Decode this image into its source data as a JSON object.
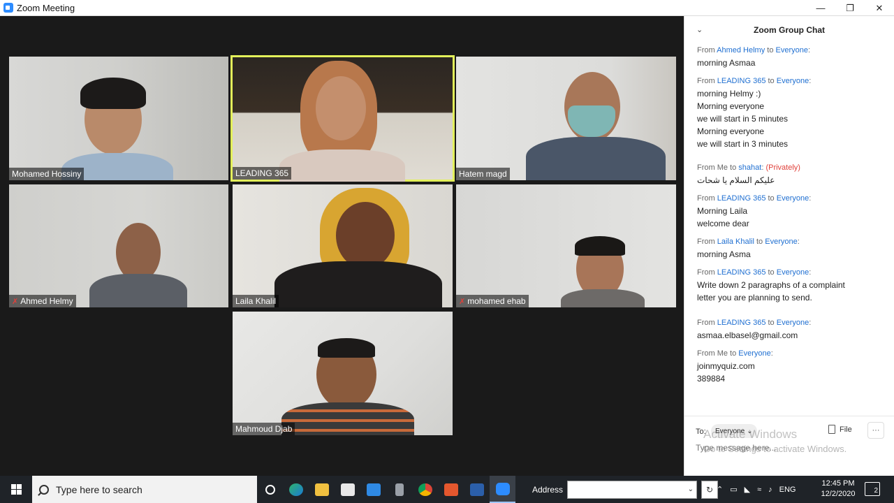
{
  "window": {
    "title": "Zoom Meeting",
    "minimize_icon": "minimize-icon",
    "restore_icon": "restore-icon",
    "close_icon": "close-icon"
  },
  "participants": [
    {
      "name": "Mohamed Hossiny",
      "muted": false
    },
    {
      "name": "LEADING 365",
      "muted": false,
      "active_speaker": true
    },
    {
      "name": "Hatem magd",
      "muted": false
    },
    {
      "name": "Ahmed Helmy",
      "muted": true
    },
    {
      "name": "Laila Khalil",
      "muted": false
    },
    {
      "name": "mohamed ehab",
      "muted": true
    },
    {
      "name": "Mahmoud Djab",
      "muted": false
    }
  ],
  "chat": {
    "title": "Zoom Group Chat",
    "messages": [
      {
        "from_label": "From ",
        "sender": "Ahmed Helmy",
        "to_label": " to ",
        "recipient": "Everyone",
        "colon": ":",
        "private": "",
        "lines": [
          "morning Asmaa"
        ]
      },
      {
        "from_label": "From ",
        "sender": "LEADING 365",
        "to_label": " to ",
        "recipient": "Everyone",
        "colon": ":",
        "private": "",
        "lines": [
          "morning Helmy :)",
          "Morning everyone",
          "we will start in 5 minutes",
          "Morning everyone",
          "we will start in 3 minutes"
        ]
      },
      {
        "from_label": "From Me to ",
        "sender": "",
        "to_label": "",
        "recipient": "shahat",
        "colon": ":",
        "private": "(Privately)",
        "lines": [
          "عليكم السلام يا شحات"
        ]
      },
      {
        "from_label": "From ",
        "sender": "LEADING 365",
        "to_label": " to ",
        "recipient": "Everyone",
        "colon": ":",
        "private": "",
        "lines": [
          "Morning Laila",
          "welcome dear"
        ]
      },
      {
        "from_label": "From ",
        "sender": "Laila Khalil",
        "to_label": " to ",
        "recipient": "Everyone",
        "colon": ":",
        "private": "",
        "lines": [
          "morning Asma"
        ]
      },
      {
        "from_label": "From ",
        "sender": "LEADING 365",
        "to_label": " to ",
        "recipient": "Everyone",
        "colon": ":",
        "private": "",
        "lines": [
          "Write down 2 paragraphs of a complaint",
          "letter you are planning to send."
        ]
      },
      {
        "from_label": "From ",
        "sender": "LEADING 365",
        "to_label": " to ",
        "recipient": "Everyone",
        "colon": ":",
        "private": "",
        "lines": [
          "asmaa.elbasel@gmail.com"
        ]
      },
      {
        "from_label": "From Me to ",
        "sender": "",
        "to_label": "",
        "recipient": "Everyone",
        "colon": ":",
        "private": "",
        "lines": [
          "joinmyquiz.com",
          "389884"
        ]
      }
    ],
    "to_label": "To:",
    "to_value": "Everyone",
    "file_label": "File",
    "more_label": "···",
    "input_placeholder": "Type message here...",
    "watermark_title": "Activate Windows",
    "watermark_sub": "Go to Settings to activate Windows."
  },
  "taskbar": {
    "search_placeholder": "Type here to search",
    "address_label": "Address",
    "lang": "ENG",
    "time": "12:45 PM",
    "date": "12/2/2020",
    "notification_count": "2"
  },
  "colors": {
    "accent": "#2d8cff",
    "active_speaker_border": "#e3f05a",
    "chat_link": "#1f6fd1",
    "muted_red": "#e0413b"
  }
}
